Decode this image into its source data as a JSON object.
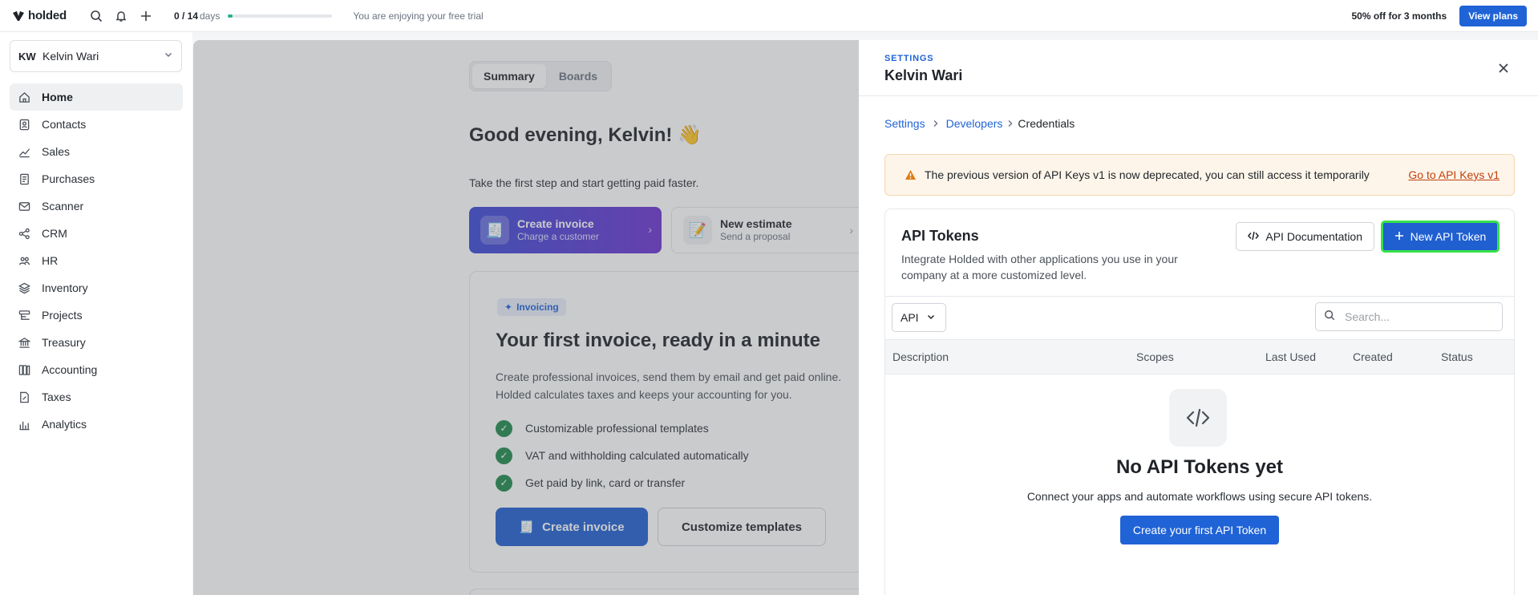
{
  "topbar": {
    "logo": "holded",
    "trial_used": "0 / 14",
    "trial_unit": "days",
    "trial_progress": 0.04,
    "trial_message": "You are enjoying your free trial",
    "promo": "50% off for 3 months",
    "view_plans": "View plans"
  },
  "account": {
    "initials": "KW",
    "name": "Kelvin Wari"
  },
  "nav": [
    {
      "label": "Home",
      "icon": "home-icon"
    },
    {
      "label": "Contacts",
      "icon": "contacts-icon"
    },
    {
      "label": "Sales",
      "icon": "sales-icon"
    },
    {
      "label": "Purchases",
      "icon": "purchases-icon"
    },
    {
      "label": "Scanner",
      "icon": "scanner-icon"
    },
    {
      "label": "CRM",
      "icon": "crm-icon"
    },
    {
      "label": "HR",
      "icon": "hr-icon"
    },
    {
      "label": "Inventory",
      "icon": "inventory-icon"
    },
    {
      "label": "Projects",
      "icon": "projects-icon"
    },
    {
      "label": "Treasury",
      "icon": "treasury-icon"
    },
    {
      "label": "Accounting",
      "icon": "accounting-icon"
    },
    {
      "label": "Taxes",
      "icon": "taxes-icon"
    },
    {
      "label": "Analytics",
      "icon": "analytics-icon"
    }
  ],
  "dashboard": {
    "tabs": [
      "Summary",
      "Boards"
    ],
    "greeting": "Good evening, Kelvin! 👋",
    "lead": "Take the first step and start getting paid faster.",
    "quick_actions": [
      {
        "title": "Create invoice",
        "subtitle": "Charge a customer",
        "emoji": "🧾"
      },
      {
        "title": "New estimate",
        "subtitle": "Send a proposal",
        "emoji": "📝"
      }
    ],
    "card": {
      "pill": "Invoicing",
      "title": "Your first invoice, ready in a minute",
      "desc_line1": "Create professional invoices, send them by email and get paid online.",
      "desc_line2": "Holded calculates taxes and keeps your accounting for you.",
      "bullets": [
        "Customizable professional templates",
        "VAT and withholding calculated automatically",
        "Get paid by link, card or transfer"
      ],
      "primary_cta": "Create invoice",
      "primary_emoji": "🧾",
      "secondary_cta": "Customize templates"
    }
  },
  "panel": {
    "label": "SETTINGS",
    "title": "Kelvin Wari",
    "breadcrumbs": [
      "Settings",
      "Developers",
      "Credentials"
    ],
    "warning": "The previous version of API Keys v1 is now deprecated, you can still access it temporarily",
    "warning_link": "Go to API Keys v1",
    "tokens": {
      "title": "API Tokens",
      "desc": "Integrate Holded with other applications you use in your company at a more customized level.",
      "doc_button": "API Documentation",
      "new_button": "New API Token",
      "filter": "API",
      "search_placeholder": "Search...",
      "columns": [
        "Description",
        "Scopes",
        "Last Used",
        "Created",
        "Status"
      ],
      "empty_title": "No API Tokens yet",
      "empty_sub": "Connect your apps and automate workflows using secure API tokens.",
      "empty_button": "Create your first API Token"
    }
  }
}
